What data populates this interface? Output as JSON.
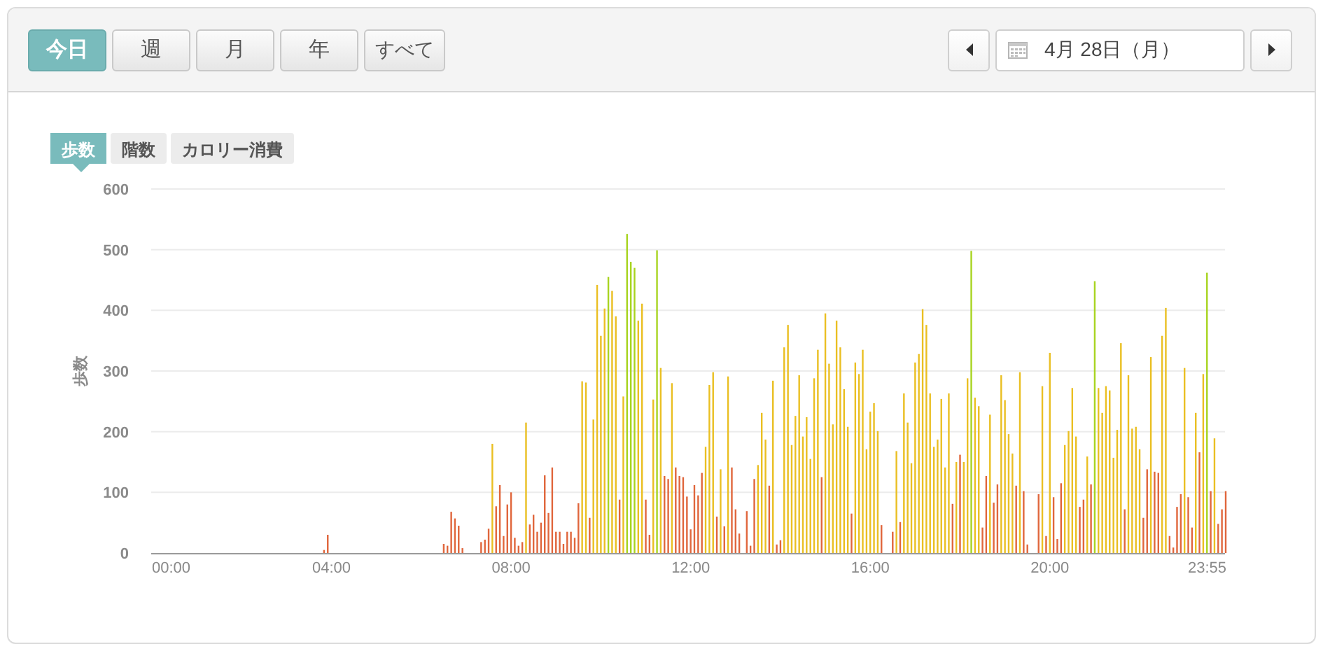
{
  "period_tabs": [
    {
      "label": "今日",
      "selected": true
    },
    {
      "label": "週",
      "selected": false
    },
    {
      "label": "月",
      "selected": false
    },
    {
      "label": "年",
      "selected": false
    },
    {
      "label": "すべて",
      "selected": false
    }
  ],
  "date_nav": {
    "date": "4月 28日（月）"
  },
  "metric_tabs": [
    {
      "label": "歩数",
      "selected": true
    },
    {
      "label": "階数",
      "selected": false
    },
    {
      "label": "カロリー消費",
      "selected": false
    }
  ],
  "chart": {
    "chart_data": {
      "type": "bar",
      "ylabel": "歩数",
      "grid": true,
      "xlim": [
        0,
        23.917
      ],
      "ylim": [
        0,
        600
      ],
      "yticks": [
        0,
        100,
        200,
        300,
        400,
        500,
        600
      ],
      "xticks": [
        {
          "value": 0,
          "label": "00:00"
        },
        {
          "value": 4,
          "label": "04:00"
        },
        {
          "value": 8,
          "label": "08:00"
        },
        {
          "value": 12,
          "label": "12:00"
        },
        {
          "value": 16,
          "label": "16:00"
        },
        {
          "value": 20,
          "label": "20:00"
        },
        {
          "value": 23.917,
          "label": "23:55"
        }
      ],
      "x": [
        3.833,
        3.917,
        6.5,
        6.583,
        6.667,
        6.75,
        6.833,
        6.917,
        7.333,
        7.417,
        7.5,
        7.583,
        7.667,
        7.75,
        7.833,
        7.917,
        8,
        8.083,
        8.167,
        8.25,
        8.333,
        8.417,
        8.5,
        8.583,
        8.667,
        8.75,
        8.833,
        8.917,
        9,
        9.083,
        9.167,
        9.25,
        9.333,
        9.417,
        9.5,
        9.583,
        9.667,
        9.75,
        9.833,
        9.917,
        10,
        10.083,
        10.167,
        10.25,
        10.333,
        10.417,
        10.5,
        10.583,
        10.667,
        10.75,
        10.833,
        10.917,
        11,
        11.083,
        11.167,
        11.25,
        11.333,
        11.417,
        11.5,
        11.583,
        11.667,
        11.75,
        11.833,
        11.917,
        12,
        12.083,
        12.167,
        12.25,
        12.333,
        12.417,
        12.5,
        12.583,
        12.667,
        12.75,
        12.833,
        12.917,
        13,
        13.083,
        13.25,
        13.333,
        13.417,
        13.5,
        13.583,
        13.667,
        13.75,
        13.833,
        13.917,
        14,
        14.083,
        14.167,
        14.25,
        14.333,
        14.417,
        14.5,
        14.583,
        14.667,
        14.75,
        14.833,
        14.917,
        15,
        15.083,
        15.167,
        15.25,
        15.333,
        15.417,
        15.5,
        15.583,
        15.667,
        15.75,
        15.833,
        15.917,
        16,
        16.083,
        16.167,
        16.25,
        16.5,
        16.583,
        16.667,
        16.75,
        16.833,
        16.917,
        17,
        17.083,
        17.167,
        17.25,
        17.333,
        17.417,
        17.5,
        17.583,
        17.667,
        17.75,
        17.833,
        17.917,
        18,
        18.083,
        18.167,
        18.25,
        18.333,
        18.417,
        18.5,
        18.583,
        18.667,
        18.75,
        18.833,
        18.917,
        19,
        19.083,
        19.167,
        19.25,
        19.333,
        19.417,
        19.5,
        19.75,
        19.833,
        19.917,
        20,
        20.083,
        20.167,
        20.25,
        20.333,
        20.417,
        20.5,
        20.583,
        20.667,
        20.75,
        20.833,
        20.917,
        21,
        21.083,
        21.167,
        21.25,
        21.333,
        21.417,
        21.5,
        21.583,
        21.667,
        21.75,
        21.833,
        21.917,
        22,
        22.083,
        22.167,
        22.25,
        22.333,
        22.417,
        22.5,
        22.583,
        22.667,
        22.75,
        22.833,
        22.917,
        23,
        23.083,
        23.167,
        23.25,
        23.333,
        23.417,
        23.5,
        23.583,
        23.667,
        23.75,
        23.833,
        23.917
      ],
      "series": [
        {
          "color": "#e0663c",
          "values": [
            5,
            30,
            15,
            12,
            68,
            57,
            45,
            8,
            18,
            22,
            40,
            null,
            77,
            112,
            28,
            80,
            100,
            25,
            12,
            18,
            null,
            47,
            63,
            35,
            50,
            128,
            66,
            141,
            35,
            35,
            15,
            35,
            35,
            25,
            82,
            null,
            null,
            58,
            null,
            null,
            null,
            null,
            null,
            null,
            null,
            88,
            null,
            null,
            null,
            null,
            null,
            null,
            88,
            30,
            null,
            null,
            null,
            127,
            122,
            null,
            141,
            127,
            125,
            93,
            39,
            112,
            95,
            132,
            null,
            null,
            null,
            60,
            null,
            44,
            null,
            141,
            72,
            32,
            69,
            12,
            122,
            null,
            null,
            null,
            111,
            null,
            14,
            21,
            null,
            null,
            null,
            null,
            null,
            null,
            null,
            null,
            null,
            null,
            125,
            null,
            null,
            null,
            null,
            null,
            null,
            null,
            65,
            null,
            null,
            null,
            null,
            null,
            null,
            null,
            46,
            35,
            null,
            51,
            null,
            null,
            null,
            null,
            null,
            null,
            null,
            null,
            null,
            null,
            null,
            null,
            null,
            81,
            null,
            162,
            null,
            null,
            null,
            null,
            null,
            42,
            127,
            null,
            83,
            113,
            null,
            null,
            null,
            null,
            111,
            null,
            102,
            14,
            97,
            null,
            28,
            null,
            92,
            23,
            115,
            null,
            null,
            null,
            null,
            76,
            88,
            null,
            113,
            null,
            null,
            null,
            null,
            null,
            null,
            null,
            null,
            72,
            null,
            null,
            null,
            null,
            58,
            138,
            null,
            134,
            132,
            null,
            null,
            28,
            9,
            76,
            97,
            null,
            92,
            42,
            null,
            166,
            null,
            null,
            102,
            null,
            48,
            72,
            102
          ]
        },
        {
          "color": "#eabf22",
          "values": [
            null,
            null,
            null,
            null,
            null,
            null,
            null,
            null,
            null,
            null,
            null,
            180,
            null,
            null,
            null,
            null,
            null,
            null,
            null,
            null,
            215,
            null,
            null,
            null,
            null,
            null,
            null,
            null,
            null,
            null,
            null,
            null,
            null,
            null,
            null,
            283,
            281,
            null,
            220,
            442,
            358,
            403,
            null,
            432,
            390,
            null,
            258,
            null,
            null,
            null,
            383,
            411,
            null,
            null,
            253,
            null,
            305,
            null,
            null,
            280,
            null,
            null,
            null,
            null,
            null,
            null,
            null,
            null,
            175,
            277,
            298,
            null,
            138,
            null,
            291,
            null,
            null,
            null,
            null,
            null,
            null,
            145,
            231,
            187,
            null,
            284,
            null,
            null,
            339,
            376,
            178,
            226,
            293,
            192,
            224,
            155,
            288,
            335,
            null,
            395,
            312,
            212,
            383,
            339,
            270,
            208,
            null,
            314,
            295,
            335,
            171,
            233,
            247,
            201,
            null,
            null,
            168,
            null,
            263,
            215,
            148,
            314,
            328,
            402,
            376,
            263,
            175,
            187,
            254,
            141,
            263,
            null,
            150,
            null,
            150,
            288,
            null,
            256,
            242,
            null,
            null,
            228,
            null,
            null,
            293,
            252,
            196,
            164,
            null,
            298,
            null,
            null,
            null,
            275,
            null,
            330,
            null,
            null,
            null,
            178,
            201,
            272,
            192,
            null,
            null,
            159,
            null,
            null,
            272,
            231,
            275,
            268,
            157,
            203,
            346,
            null,
            293,
            205,
            208,
            171,
            null,
            null,
            323,
            null,
            null,
            358,
            404,
            null,
            null,
            null,
            null,
            305,
            null,
            null,
            231,
            null,
            295,
            null,
            null,
            189,
            null,
            null,
            null
          ]
        },
        {
          "color": "#a8d420",
          "values": [
            null,
            null,
            null,
            null,
            null,
            null,
            null,
            null,
            null,
            null,
            null,
            null,
            null,
            null,
            null,
            null,
            null,
            null,
            null,
            null,
            null,
            null,
            null,
            null,
            null,
            null,
            null,
            null,
            null,
            null,
            null,
            null,
            null,
            null,
            null,
            null,
            null,
            null,
            null,
            null,
            null,
            null,
            455,
            null,
            null,
            null,
            null,
            526,
            480,
            470,
            null,
            null,
            null,
            null,
            null,
            499,
            null,
            null,
            null,
            null,
            null,
            null,
            null,
            null,
            null,
            null,
            null,
            null,
            null,
            null,
            null,
            null,
            null,
            null,
            null,
            null,
            null,
            null,
            null,
            null,
            null,
            null,
            null,
            null,
            null,
            null,
            null,
            null,
            null,
            null,
            null,
            null,
            null,
            null,
            null,
            null,
            null,
            null,
            null,
            null,
            null,
            null,
            null,
            null,
            null,
            null,
            null,
            null,
            null,
            null,
            null,
            null,
            null,
            null,
            null,
            null,
            null,
            null,
            null,
            null,
            null,
            null,
            null,
            null,
            null,
            null,
            null,
            null,
            null,
            null,
            null,
            null,
            null,
            null,
            null,
            null,
            498,
            null,
            null,
            null,
            null,
            null,
            null,
            null,
            null,
            null,
            null,
            null,
            null,
            null,
            null,
            null,
            null,
            null,
            null,
            null,
            null,
            null,
            null,
            null,
            null,
            null,
            null,
            null,
            null,
            null,
            null,
            448,
            null,
            null,
            null,
            null,
            null,
            null,
            null,
            null,
            null,
            null,
            null,
            null,
            null,
            null,
            null,
            null,
            null,
            null,
            null,
            null,
            null,
            null,
            null,
            null,
            null,
            null,
            null,
            null,
            null,
            462,
            null,
            null,
            null,
            null,
            null
          ]
        }
      ]
    }
  }
}
